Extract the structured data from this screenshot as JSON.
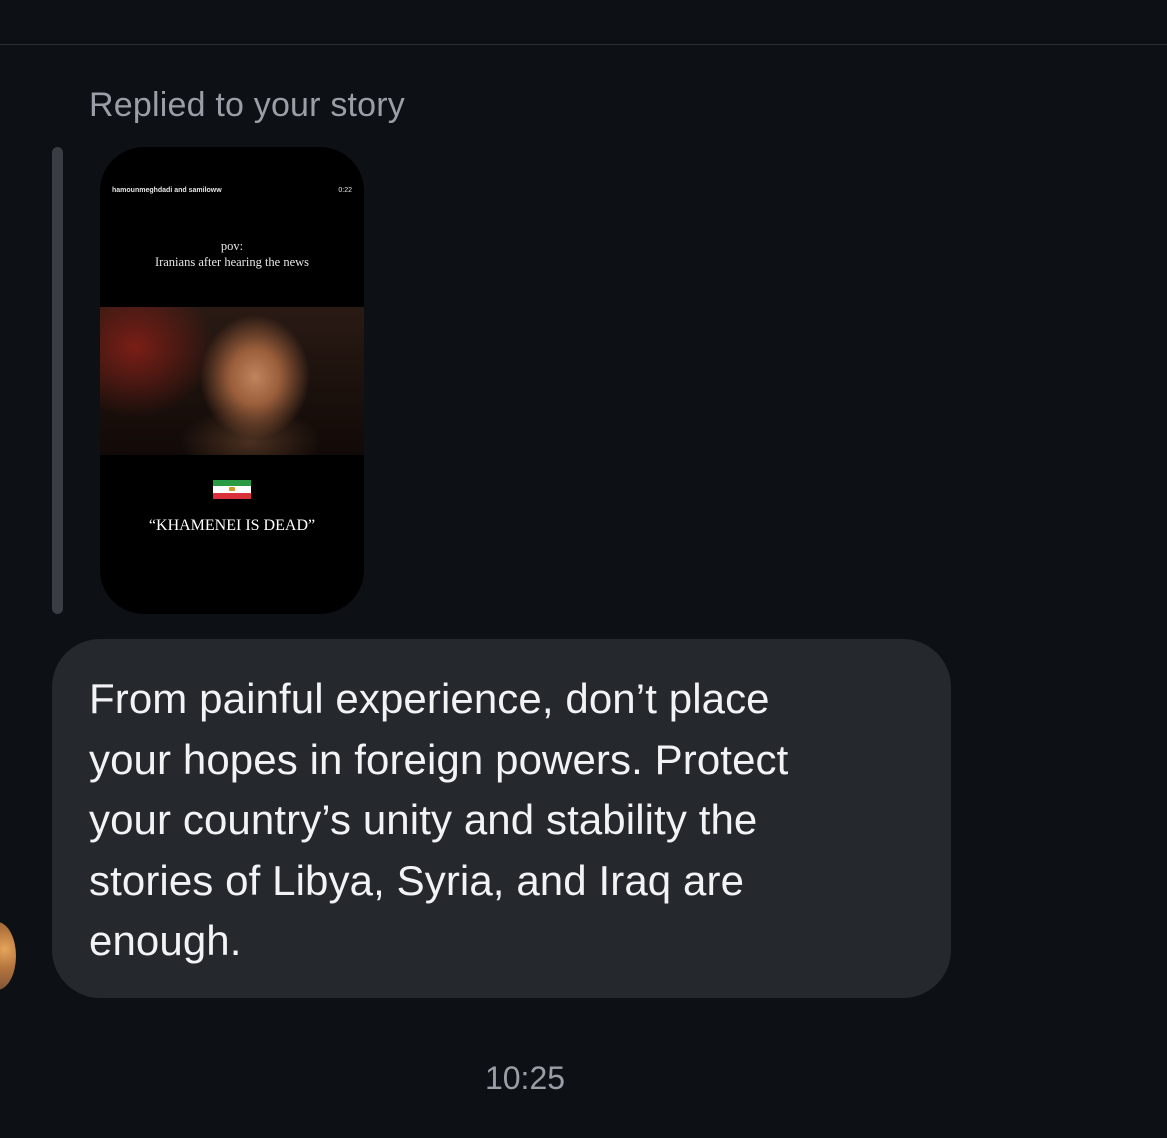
{
  "reply": {
    "label": "Replied to your story"
  },
  "story": {
    "author": "hamounmeghdadi and samiloww",
    "duration": "0:22",
    "caption_line1": "pov:",
    "caption_line2": "Iranians after hearing the news",
    "quote": "“KHAMENEI IS DEAD”",
    "flag_icon": "iran-lion-and-sun-flag-icon"
  },
  "message": {
    "text": "From painful experience, don’t place\nyour hopes in foreign powers. Protect\nyour country’s unity and stability the\nstories of Libya, Syria, and Iraq are\nenough."
  },
  "timestamp": "10:25",
  "colors": {
    "background": "#0d1015",
    "bubble": "#25282d",
    "secondary_text": "#9a9ea6",
    "primary_text": "#f2f3f5"
  }
}
